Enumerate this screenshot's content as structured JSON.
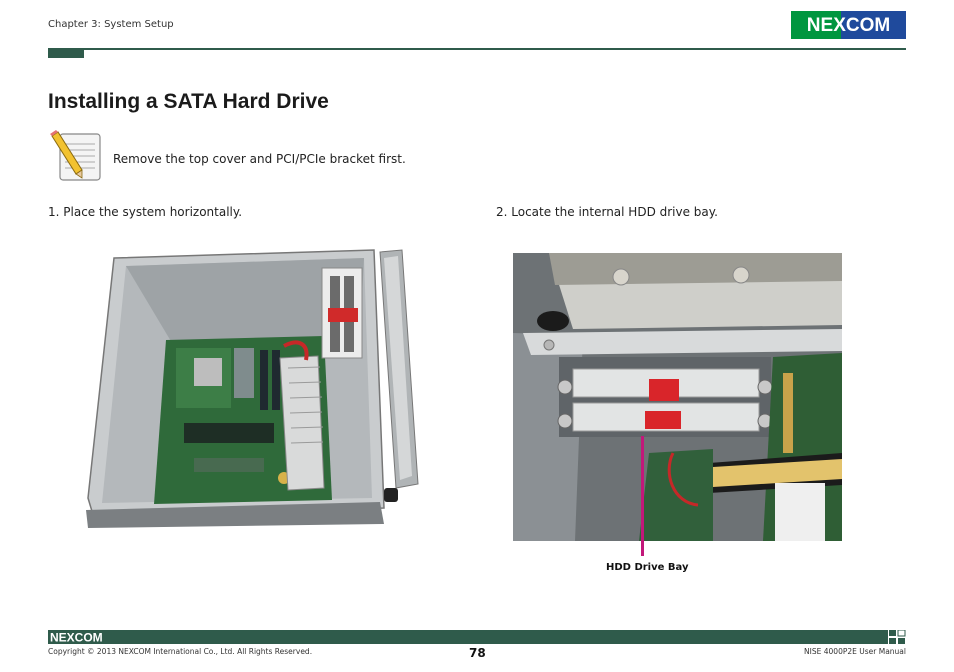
{
  "header": {
    "chapter": "Chapter 3: System Setup",
    "logo_text": "NEXCOM",
    "colors": {
      "brand_green": "#2f5b4b",
      "logo_green": "#00963f",
      "logo_blue": "#1f4a9c"
    }
  },
  "page": {
    "title": "Installing a SATA Hard Drive",
    "note": {
      "icon": "note-pencil-icon",
      "text": "Remove the top cover and PCI/PCIe bracket first."
    },
    "steps": [
      {
        "text": "1. Place the system horizontally."
      },
      {
        "text": "2. Locate the internal HDD drive bay."
      }
    ],
    "callout": {
      "label": "HDD Drive Bay",
      "color": "#c2187a"
    }
  },
  "footer": {
    "logo_text": "NEXCOM",
    "copyright": "Copyright © 2013 NEXCOM International Co., Ltd. All Rights Reserved.",
    "page_number": "78",
    "manual": "NISE 4000P2E User Manual"
  }
}
